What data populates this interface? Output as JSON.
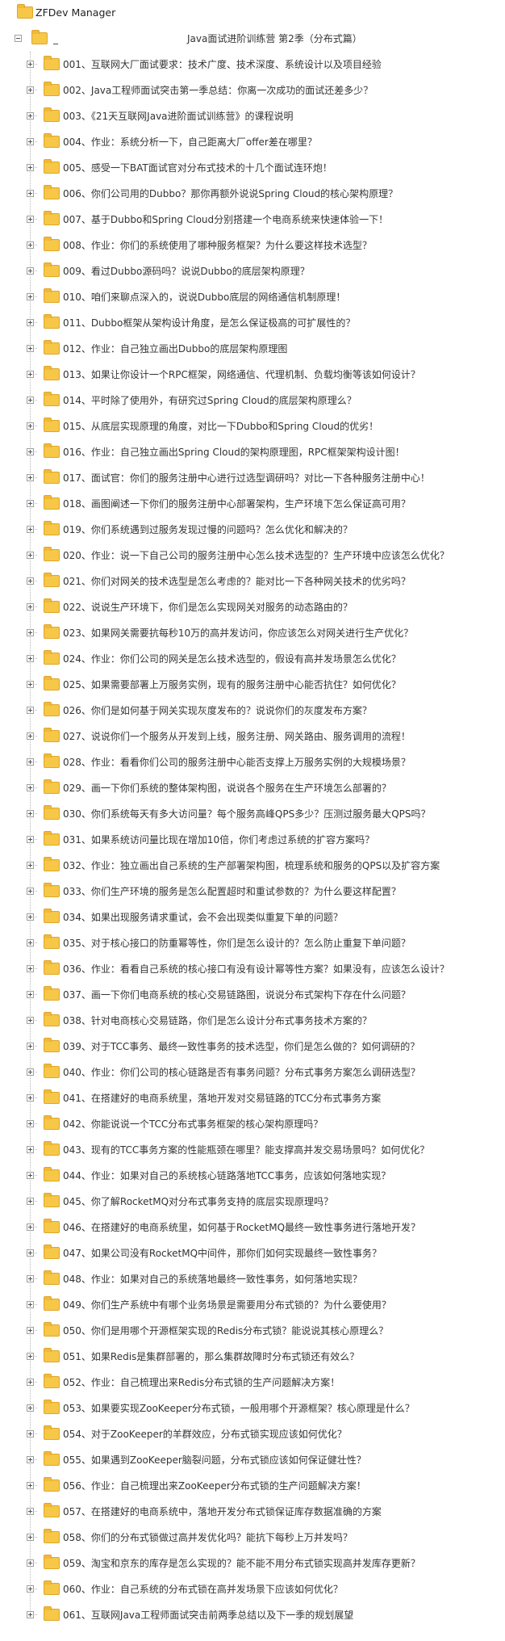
{
  "root": {
    "label": "ZFDev Manager",
    "icon": "folder-icon"
  },
  "level1": {
    "dash": "_",
    "title": "Java面试进阶训练营 第2季（分布式篇）",
    "icon": "folder-icon"
  },
  "items": [
    "001、互联网大厂面试要求：技术广度、技术深度、系统设计以及项目经验",
    "002、Java工程师面试突击第一季总结：你离一次成功的面试还差多少？",
    "003、《21天互联网Java进阶面试训练营》的课程说明",
    "004、作业：系统分析一下，自己距离大厂offer差在哪里？",
    "005、感受一下BAT面试官对分布式技术的十几个面试连环炮！",
    "006、你们公司用的Dubbo？那你再额外说说Spring Cloud的核心架构原理？",
    "007、基于Dubbo和Spring Cloud分别搭建一个电商系统来快速体验一下！",
    "008、作业：你们的系统使用了哪种服务框架？为什么要这样技术选型？",
    "009、看过Dubbo源码吗？说说Dubbo的底层架构原理？",
    "010、咱们来聊点深入的，说说Dubbo底层的网络通信机制原理！",
    "011、Dubbo框架从架构设计角度，是怎么保证极高的可扩展性的？",
    "012、作业：自己独立画出Dubbo的底层架构原理图",
    "013、如果让你设计一个RPC框架，网络通信、代理机制、负载均衡等该如何设计？",
    "014、平时除了使用外，有研究过Spring Cloud的底层架构原理么？",
    "015、从底层实现原理的角度，对比一下Dubbo和Spring Cloud的优劣！",
    "016、作业：自己独立画出Spring Cloud的架构原理图，RPC框架架构设计图！",
    "017、面试官：你们的服务注册中心进行过选型调研吗？对比一下各种服务注册中心！",
    "018、画图阐述一下你们的服务注册中心部署架构，生产环境下怎么保证高可用？",
    "019、你们系统遇到过服务发现过慢的问题吗？怎么优化和解决的？",
    "020、作业：说一下自己公司的服务注册中心怎么技术选型的？生产环境中应该怎么优化？",
    "021、你们对网关的技术选型是怎么考虑的？能对比一下各种网关技术的优劣吗？",
    "022、说说生产环境下，你们是怎么实现网关对服务的动态路由的？",
    "023、如果网关需要抗每秒10万的高并发访问，你应该怎么对网关进行生产优化？",
    "024、作业：你们公司的网关是怎么技术选型的，假设有高并发场景怎么优化？",
    "025、如果需要部署上万服务实例，现有的服务注册中心能否抗住？如何优化？",
    "026、你们是如何基于网关实现灰度发布的？说说你们的灰度发布方案？",
    "027、说说你们一个服务从开发到上线，服务注册、网关路由、服务调用的流程！",
    "028、作业：看看你们公司的服务注册中心能否支撑上万服务实例的大规模场景？",
    "029、画一下你们系统的整体架构图，说说各个服务在生产环境怎么部署的？",
    "030、你们系统每天有多大访问量？每个服务高峰QPS多少？压测过服务最大QPS吗？",
    "031、如果系统访问量比现在增加10倍，你们考虑过系统的扩容方案吗？",
    "032、作业：独立画出自己系统的生产部署架构图，梳理系统和服务的QPS以及扩容方案",
    "033、你们生产环境的服务是怎么配置超时和重试参数的？为什么要这样配置？",
    "034、如果出现服务请求重试，会不会出现类似重复下单的问题？",
    "035、对于核心接口的防重幂等性，你们是怎么设计的？怎么防止重复下单问题？",
    "036、作业：看看自己系统的核心接口有没有设计幂等性方案？如果没有，应该怎么设计？",
    "037、画一下你们电商系统的核心交易链路图，说说分布式架构下存在什么问题？",
    "038、针对电商核心交易链路，你们是怎么设计分布式事务技术方案的？",
    "039、对于TCC事务、最终一致性事务的技术选型，你们是怎么做的？如何调研的？",
    "040、作业：你们公司的核心链路是否有事务问题？分布式事务方案怎么调研选型？",
    "041、在搭建好的电商系统里，落地开发对交易链路的TCC分布式事务方案",
    "042、你能说说一个TCC分布式事务框架的核心架构原理吗？",
    "043、现有的TCC事务方案的性能瓶颈在哪里？能支撑高并发交易场景吗？如何优化？",
    "044、作业：如果对自己的系统核心链路落地TCC事务，应该如何落地实现？",
    "045、你了解RocketMQ对分布式事务支持的底层实现原理吗？",
    "046、在搭建好的电商系统里，如何基于RocketMQ最终一致性事务进行落地开发？",
    "047、如果公司没有RocketMQ中间件，那你们如何实现最终一致性事务？",
    "048、作业：如果对自己的系统落地最终一致性事务，如何落地实现？",
    "049、你们生产系统中有哪个业务场景是需要用分布式锁的？为什么要使用？",
    "050、你们是用哪个开源框架实现的Redis分布式锁？能说说其核心原理么？",
    "051、如果Redis是集群部署的，那么集群故障时分布式锁还有效么？",
    "052、作业：自己梳理出来Redis分布式锁的生产问题解决方案！",
    "053、如果要实现ZooKeeper分布式锁，一般用哪个开源框架？核心原理是什么？",
    "054、对于ZooKeeper的羊群效应，分布式锁实现应该如何优化？",
    "055、如果遇到ZooKeeper脑裂问题，分布式锁应该如何保证健壮性？",
    "056、作业：自己梳理出来ZooKeeper分布式锁的生产问题解决方案！",
    "057、在搭建好的电商系统中，落地开发分布式锁保证库存数据准确的方案",
    "058、你们的分布式锁做过高并发优化吗？能抗下每秒上万并发吗？",
    "059、淘宝和京东的库存是怎么实现的？能不能不用分布式锁实现高并发库存更新？",
    "060、作业：自己系统的分布式锁在高并发场景下应该如何优化？",
    "061、互联网Java工程师面试突击前两季总结以及下一季的规划展望"
  ]
}
